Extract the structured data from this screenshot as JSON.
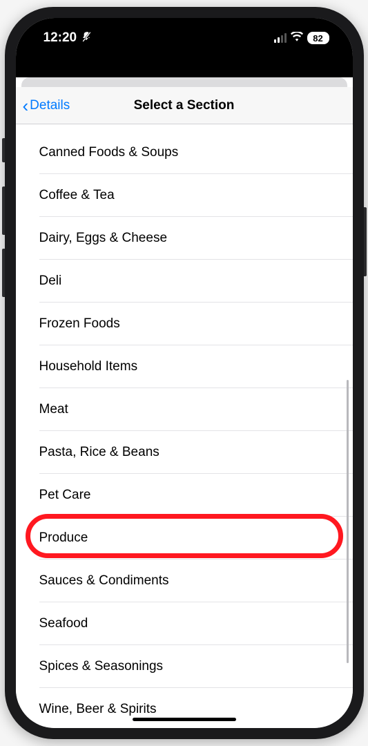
{
  "status": {
    "time": "12:20",
    "battery": "82"
  },
  "nav": {
    "back_label": "Details",
    "title": "Select a Section"
  },
  "sections": [
    {
      "label": "Canned Foods & Soups"
    },
    {
      "label": "Coffee & Tea"
    },
    {
      "label": "Dairy, Eggs & Cheese"
    },
    {
      "label": "Deli"
    },
    {
      "label": "Frozen Foods"
    },
    {
      "label": "Household Items"
    },
    {
      "label": "Meat"
    },
    {
      "label": "Pasta, Rice & Beans"
    },
    {
      "label": "Pet Care"
    },
    {
      "label": "Produce"
    },
    {
      "label": "Sauces & Condiments"
    },
    {
      "label": "Seafood"
    },
    {
      "label": "Spices & Seasonings"
    },
    {
      "label": "Wine, Beer & Spirits"
    }
  ],
  "highlighted_index": 9
}
